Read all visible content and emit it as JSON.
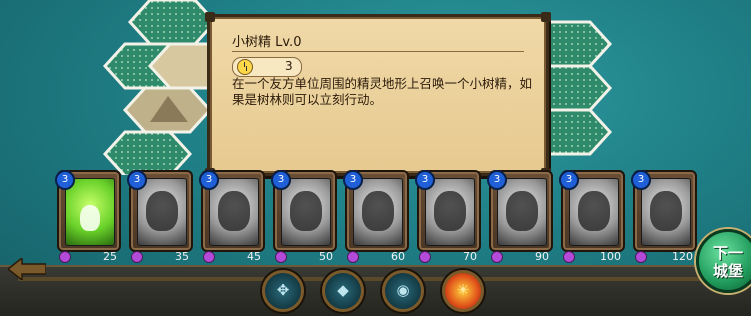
{
  "tooltip": {
    "title": "小树精 Lv.0",
    "cost": "3",
    "description": "在一个友方单位周围的精灵地形上召唤一个小树精，如果是树林则可以立刻行动。"
  },
  "cards": [
    {
      "level": "3",
      "price": "25",
      "icon": "treant-icon",
      "active": true
    },
    {
      "level": "3",
      "price": "35",
      "icon": "plant-monster-icon",
      "active": false
    },
    {
      "level": "3",
      "price": "45",
      "icon": "turtle-icon",
      "active": false
    },
    {
      "level": "3",
      "price": "50",
      "icon": "flower-icon",
      "active": false
    },
    {
      "level": "3",
      "price": "60",
      "icon": "dark-spirit-icon",
      "active": false
    },
    {
      "level": "3",
      "price": "70",
      "icon": "golem-icon",
      "active": false
    },
    {
      "level": "3",
      "price": "90",
      "icon": "seal-icon",
      "active": false
    },
    {
      "level": "3",
      "price": "100",
      "icon": "unicorn-icon",
      "active": false
    },
    {
      "level": "3",
      "price": "120",
      "icon": "dragon-icon",
      "active": false
    }
  ],
  "actions": [
    {
      "icon": "rune-icon",
      "sym": "✥"
    },
    {
      "icon": "shield-icon",
      "sym": "◆"
    },
    {
      "icon": "mask-icon",
      "sym": "◉"
    },
    {
      "icon": "fire-swirl-icon",
      "sym": "☀"
    }
  ],
  "next_castle": {
    "line1": "下一",
    "line2": "城堡"
  },
  "colors": {
    "accent": "#1f9a5a",
    "parchment": "#e6c98f"
  }
}
